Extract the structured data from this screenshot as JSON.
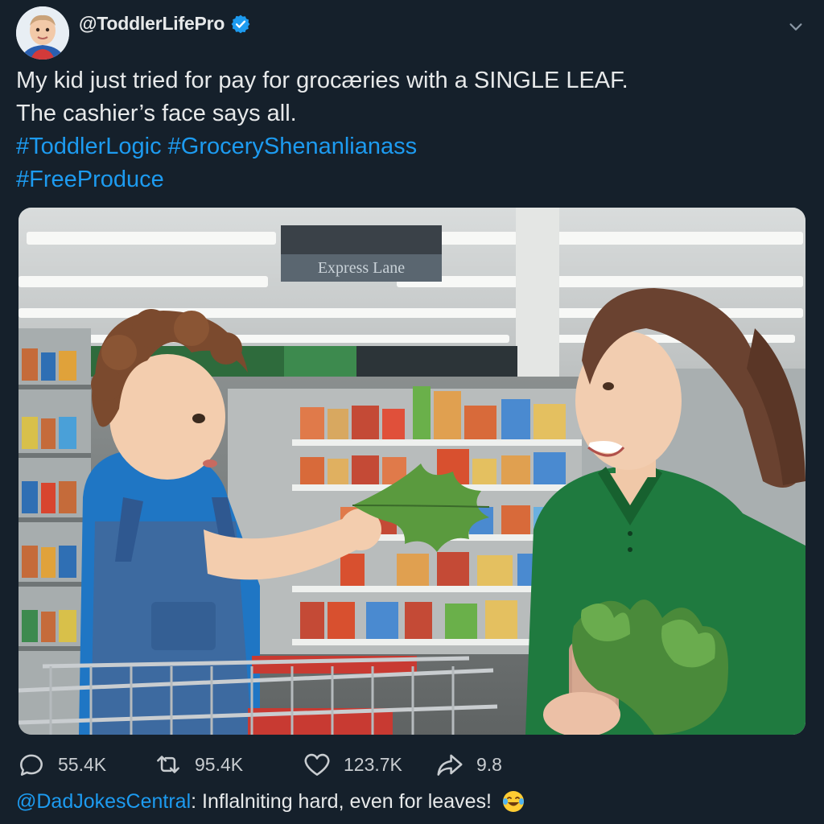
{
  "post": {
    "handle": "@ToddlerLifePro",
    "text_line1": "My kid just tried for pay for grocæries with a SINGLE LEAF.",
    "text_line2": "The cashier’s face says all.",
    "hashtags_line1": "#ToddlerLogic #GroceryShenanlianass",
    "hashtags_line2": "#FreeProduce"
  },
  "media": {
    "store_sign": "Express Lane"
  },
  "actions": {
    "replies": "55.4K",
    "reposts": "95.4K",
    "likes": "123.7K",
    "shares": "9.8"
  },
  "reply": {
    "mention": "@DadJokesCentral",
    "text": ": Inflalniting hard, even for leaves!"
  },
  "colors": {
    "background": "#15202b",
    "link": "#1d9bf0",
    "text": "#e7e9ea",
    "muted": "#c8ccd0"
  },
  "icons": [
    "verified-badge-icon",
    "chevron-down-icon",
    "reply-icon",
    "repost-icon",
    "like-icon",
    "share-icon",
    "laughing-emoji-icon"
  ]
}
